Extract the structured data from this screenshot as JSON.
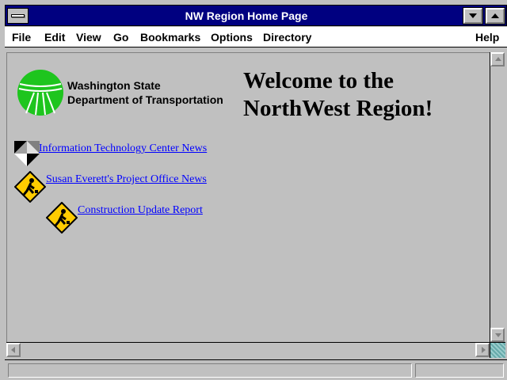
{
  "window": {
    "title": "NW Region Home Page"
  },
  "menu": {
    "items": [
      "File",
      "Edit",
      "View",
      "Go",
      "Bookmarks",
      "Options",
      "Directory"
    ],
    "help": "Help"
  },
  "header": {
    "org_line1": "Washington State",
    "org_line2": "Department of Transportation",
    "welcome_line1": "Welcome to the",
    "welcome_line2": "NorthWest Region!"
  },
  "links": [
    {
      "label": "Information Technology Center News",
      "icon": "diamond-tile-icon"
    },
    {
      "label": "Susan Everett's Project Office News",
      "icon": "men-at-work-icon"
    },
    {
      "label": "Construction Update Report",
      "icon": "men-at-work-icon"
    }
  ],
  "colors": {
    "title_bar": "#000080",
    "link": "#0000ff",
    "logo_green": "#1ec51e",
    "sign_yellow": "#ffcc00",
    "background": "#c0c0c0"
  }
}
